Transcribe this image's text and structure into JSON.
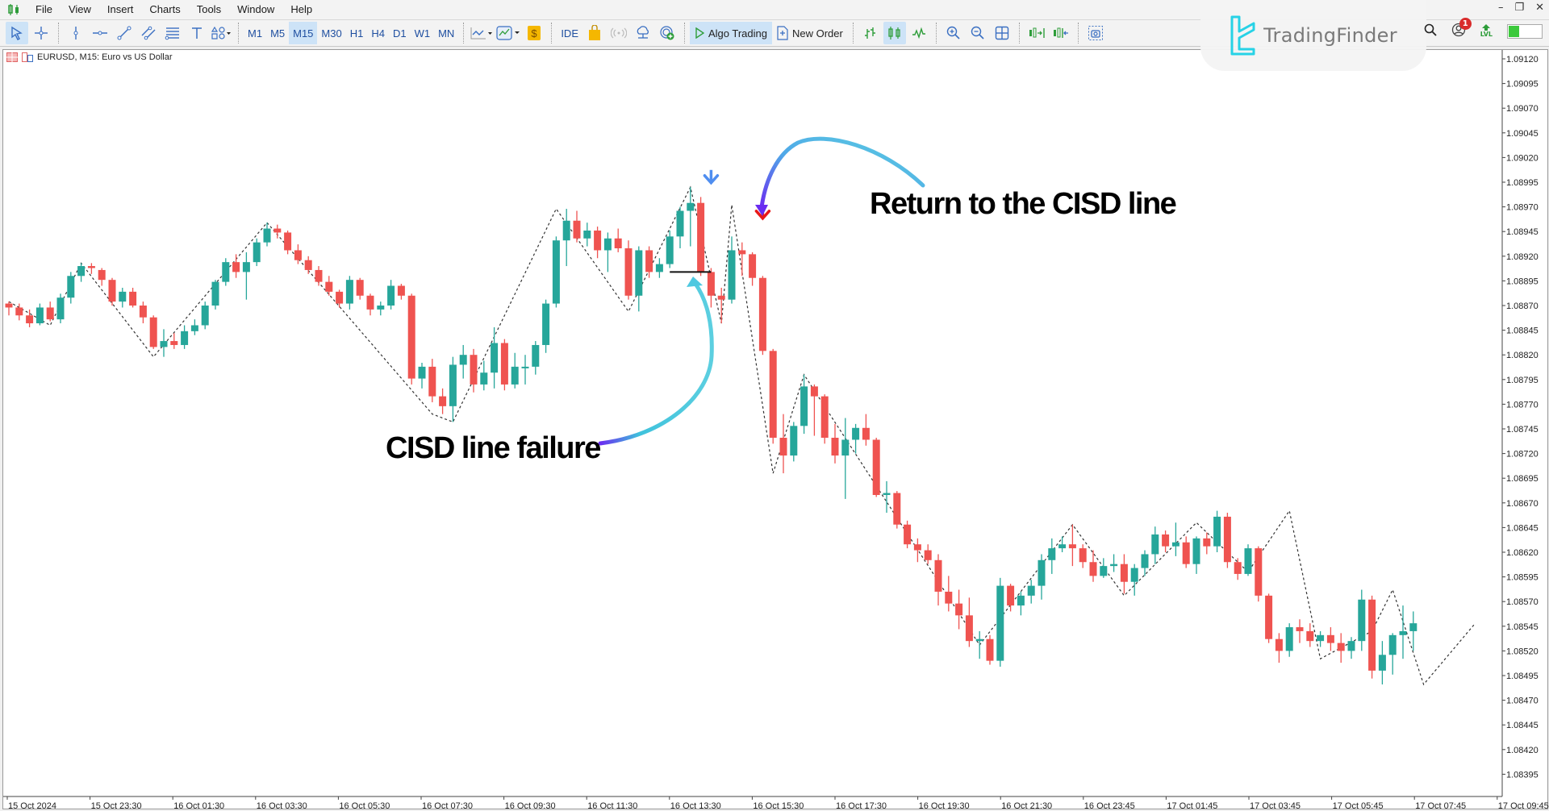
{
  "app": {
    "menu": [
      "File",
      "View",
      "Insert",
      "Charts",
      "Tools",
      "Window",
      "Help"
    ],
    "window_controls": [
      "minimize",
      "restore",
      "close"
    ]
  },
  "toolbar": {
    "drawing_tools": [
      "cursor-icon",
      "crosshair-icon",
      "vertical-line-icon",
      "horizontal-line-icon",
      "trendline-icon",
      "channel-icon",
      "fibonacci-icon",
      "text-icon",
      "shapes-icon"
    ],
    "timeframes": [
      "M1",
      "M5",
      "M15",
      "M30",
      "H1",
      "H4",
      "D1",
      "W1",
      "MN"
    ],
    "active_timeframe": "M15",
    "ide_label": "IDE",
    "algo_trading_label": "Algo Trading",
    "new_order_label": "New Order",
    "notification_count": "1",
    "level_label": "LVL",
    "level_progress": 0.3
  },
  "brand": {
    "name": "TradingFinder"
  },
  "chart": {
    "title": "EURUSD, M15:  Euro vs US Dollar",
    "bull_color": "#26a69a",
    "bear_color": "#ef5350",
    "annotations": {
      "failure": "CISD line failure",
      "return": "Return to the CISD line"
    }
  },
  "chart_data": {
    "type": "candlestick",
    "symbol": "EURUSD",
    "timeframe": "M15",
    "title": "EURUSD, M15:  Euro vs US Dollar",
    "ylim": [
      1.0837,
      1.09145
    ],
    "y_ticks": [
      "1.09120",
      "1.09095",
      "1.09070",
      "1.09045",
      "1.09020",
      "1.08995",
      "1.08970",
      "1.08945",
      "1.08920",
      "1.08895",
      "1.08870",
      "1.08845",
      "1.08820",
      "1.08795",
      "1.08770",
      "1.08745",
      "1.08720",
      "1.08695",
      "1.08670",
      "1.08645",
      "1.08620",
      "1.08595",
      "1.08570",
      "1.08545",
      "1.08520",
      "1.08495",
      "1.08470",
      "1.08445",
      "1.08420",
      "1.08395"
    ],
    "x_ticks": [
      "15 Oct 2024",
      "15 Oct 23:30",
      "16 Oct 01:30",
      "16 Oct 03:30",
      "16 Oct 05:30",
      "16 Oct 07:30",
      "16 Oct 09:30",
      "16 Oct 11:30",
      "16 Oct 13:30",
      "16 Oct 15:30",
      "16 Oct 17:30",
      "16 Oct 19:30",
      "16 Oct 21:30",
      "16 Oct 23:45",
      "17 Oct 01:45",
      "17 Oct 03:45",
      "17 Oct 05:45",
      "17 Oct 07:45",
      "17 Oct 09:45"
    ],
    "candles": [
      [
        1.08872,
        1.08874,
        1.0886,
        1.08868
      ],
      [
        1.08868,
        1.08872,
        1.08855,
        1.0886
      ],
      [
        1.0886,
        1.08866,
        1.08848,
        1.08852
      ],
      [
        1.08852,
        1.08872,
        1.0885,
        1.08868
      ],
      [
        1.08868,
        1.08874,
        1.08854,
        1.08856
      ],
      [
        1.08856,
        1.08882,
        1.08852,
        1.08878
      ],
      [
        1.08878,
        1.08904,
        1.08872,
        1.089
      ],
      [
        1.089,
        1.08913,
        1.08894,
        1.0891
      ],
      [
        1.0891,
        1.08913,
        1.08902,
        1.08908
      ],
      [
        1.08906,
        1.08908,
        1.0889,
        1.08896
      ],
      [
        1.08896,
        1.08898,
        1.0887,
        1.08874
      ],
      [
        1.08874,
        1.08888,
        1.08868,
        1.08884
      ],
      [
        1.08884,
        1.08888,
        1.08868,
        1.0887
      ],
      [
        1.0887,
        1.08874,
        1.08852,
        1.08858
      ],
      [
        1.08858,
        1.0886,
        1.08826,
        1.08828
      ],
      [
        1.08828,
        1.08846,
        1.08818,
        1.08834
      ],
      [
        1.08834,
        1.08842,
        1.08826,
        1.0883
      ],
      [
        1.0883,
        1.0885,
        1.08826,
        1.08844
      ],
      [
        1.08844,
        1.08856,
        1.0884,
        1.0885
      ],
      [
        1.0885,
        1.08874,
        1.08846,
        1.0887
      ],
      [
        1.0887,
        1.08896,
        1.08866,
        1.08894
      ],
      [
        1.08894,
        1.08918,
        1.0889,
        1.08914
      ],
      [
        1.08914,
        1.08922,
        1.08898,
        1.08904
      ],
      [
        1.08904,
        1.08924,
        1.08876,
        1.08914
      ],
      [
        1.08914,
        1.08938,
        1.0891,
        1.08934
      ],
      [
        1.08934,
        1.08954,
        1.0893,
        1.08948
      ],
      [
        1.08948,
        1.08952,
        1.08938,
        1.08944
      ],
      [
        1.08944,
        1.08946,
        1.08922,
        1.08926
      ],
      [
        1.08926,
        1.08932,
        1.08912,
        1.08916
      ],
      [
        1.08916,
        1.0892,
        1.08902,
        1.08906
      ],
      [
        1.08906,
        1.0891,
        1.0889,
        1.08894
      ],
      [
        1.08894,
        1.089,
        1.0888,
        1.08884
      ],
      [
        1.08884,
        1.08886,
        1.08868,
        1.08872
      ],
      [
        1.08872,
        1.089,
        1.08866,
        1.08896
      ],
      [
        1.08896,
        1.08898,
        1.08876,
        1.0888
      ],
      [
        1.0888,
        1.08882,
        1.0886,
        1.08866
      ],
      [
        1.08866,
        1.08874,
        1.0886,
        1.0887
      ],
      [
        1.0887,
        1.08896,
        1.08866,
        1.0889
      ],
      [
        1.0889,
        1.08892,
        1.08876,
        1.0888
      ],
      [
        1.0888,
        1.08882,
        1.0879,
        1.08796
      ],
      [
        1.08796,
        1.08812,
        1.08786,
        1.08808
      ],
      [
        1.08808,
        1.08816,
        1.08772,
        1.08778
      ],
      [
        1.08778,
        1.08786,
        1.0876,
        1.08768
      ],
      [
        1.08768,
        1.08818,
        1.08752,
        1.0881
      ],
      [
        1.0881,
        1.0883,
        1.08796,
        1.0882
      ],
      [
        1.0882,
        1.08826,
        1.08782,
        1.0879
      ],
      [
        1.0879,
        1.08814,
        1.08784,
        1.08802
      ],
      [
        1.08802,
        1.08848,
        1.08786,
        1.08832
      ],
      [
        1.08832,
        1.08836,
        1.08784,
        1.0879
      ],
      [
        1.0879,
        1.08822,
        1.08786,
        1.08808
      ],
      [
        1.08808,
        1.0882,
        1.0879,
        1.08808
      ],
      [
        1.08808,
        1.08834,
        1.088,
        1.0883
      ],
      [
        1.0883,
        1.08876,
        1.08822,
        1.08872
      ],
      [
        1.08872,
        1.0894,
        1.08868,
        1.08936
      ],
      [
        1.08936,
        1.08968,
        1.0891,
        1.08956
      ],
      [
        1.08956,
        1.08966,
        1.08934,
        1.08938
      ],
      [
        1.08938,
        1.08954,
        1.0893,
        1.08946
      ],
      [
        1.08946,
        1.0895,
        1.08918,
        1.08926
      ],
      [
        1.08926,
        1.08944,
        1.08904,
        1.08938
      ],
      [
        1.08938,
        1.08948,
        1.08924,
        1.08928
      ],
      [
        1.08928,
        1.08936,
        1.08876,
        1.0888
      ],
      [
        1.0888,
        1.0893,
        1.08864,
        1.08926
      ],
      [
        1.08926,
        1.0893,
        1.08898,
        1.08904
      ],
      [
        1.08904,
        1.08918,
        1.08898,
        1.08912
      ],
      [
        1.08912,
        1.08946,
        1.08908,
        1.0894
      ],
      [
        1.0894,
        1.0897,
        1.08928,
        1.08966
      ],
      [
        1.08966,
        1.0899,
        1.0893,
        1.08974
      ],
      [
        1.08974,
        1.0898,
        1.089,
        1.08904
      ],
      [
        1.08904,
        1.08908,
        1.08868,
        1.0888
      ],
      [
        1.0888,
        1.08888,
        1.08852,
        1.08876
      ],
      [
        1.08876,
        1.0894,
        1.08872,
        1.08926
      ],
      [
        1.08926,
        1.08934,
        1.089,
        1.08922
      ],
      [
        1.08922,
        1.08924,
        1.0889,
        1.08898
      ],
      [
        1.08898,
        1.089,
        1.0882,
        1.08824
      ],
      [
        1.08824,
        1.08826,
        1.0873,
        1.08736
      ],
      [
        1.08736,
        1.0876,
        1.087,
        1.08718
      ],
      [
        1.08718,
        1.08752,
        1.08712,
        1.08748
      ],
      [
        1.08748,
        1.088,
        1.0874,
        1.08788
      ],
      [
        1.08788,
        1.0879,
        1.08738,
        1.08778
      ],
      [
        1.08778,
        1.0878,
        1.0873,
        1.08736
      ],
      [
        1.08736,
        1.0875,
        1.0871,
        1.08718
      ],
      [
        1.08718,
        1.08756,
        1.08674,
        1.08734
      ],
      [
        1.08734,
        1.0875,
        1.0872,
        1.08746
      ],
      [
        1.08746,
        1.0876,
        1.08728,
        1.08734
      ],
      [
        1.08734,
        1.08736,
        1.08676,
        1.08678
      ],
      [
        1.08678,
        1.08692,
        1.0866,
        1.0868
      ],
      [
        1.0868,
        1.08682,
        1.08644,
        1.08648
      ],
      [
        1.08648,
        1.08652,
        1.08624,
        1.08628
      ],
      [
        1.08628,
        1.08634,
        1.0861,
        1.08622
      ],
      [
        1.08622,
        1.08628,
        1.08608,
        1.08612
      ],
      [
        1.08612,
        1.08618,
        1.08566,
        1.0858
      ],
      [
        1.0858,
        1.08596,
        1.0856,
        1.08568
      ],
      [
        1.08568,
        1.08582,
        1.08542,
        1.08556
      ],
      [
        1.08556,
        1.08574,
        1.08524,
        1.0853
      ],
      [
        1.0853,
        1.0854,
        1.08512,
        1.08532
      ],
      [
        1.08532,
        1.08536,
        1.08506,
        1.0851
      ],
      [
        1.0851,
        1.08594,
        1.08504,
        1.08586
      ],
      [
        1.08586,
        1.08588,
        1.0856,
        1.08566
      ],
      [
        1.08566,
        1.0858,
        1.08556,
        1.08576
      ],
      [
        1.08576,
        1.08592,
        1.08568,
        1.08586
      ],
      [
        1.08586,
        1.08618,
        1.08572,
        1.08612
      ],
      [
        1.08612,
        1.08634,
        1.08598,
        1.08624
      ],
      [
        1.08624,
        1.08636,
        1.0862,
        1.08628
      ],
      [
        1.08628,
        1.08648,
        1.08606,
        1.08624
      ],
      [
        1.08624,
        1.08628,
        1.08604,
        1.0861
      ],
      [
        1.0861,
        1.08622,
        1.0859,
        1.08596
      ],
      [
        1.08596,
        1.08614,
        1.08594,
        1.08606
      ],
      [
        1.08606,
        1.08618,
        1.086,
        1.08608
      ],
      [
        1.08608,
        1.08618,
        1.08578,
        1.0859
      ],
      [
        1.0859,
        1.08608,
        1.08576,
        1.08604
      ],
      [
        1.08604,
        1.08622,
        1.08596,
        1.08618
      ],
      [
        1.08618,
        1.08646,
        1.08608,
        1.08638
      ],
      [
        1.08638,
        1.08642,
        1.0862,
        1.08626
      ],
      [
        1.08626,
        1.0865,
        1.08616,
        1.0863
      ],
      [
        1.0863,
        1.08636,
        1.08604,
        1.08608
      ],
      [
        1.08608,
        1.08636,
        1.08598,
        1.08634
      ],
      [
        1.08634,
        1.0864,
        1.08618,
        1.08626
      ],
      [
        1.08626,
        1.08662,
        1.0862,
        1.08656
      ],
      [
        1.08656,
        1.0866,
        1.08604,
        1.0861
      ],
      [
        1.0861,
        1.08614,
        1.08592,
        1.08598
      ],
      [
        1.08598,
        1.08628,
        1.08596,
        1.08624
      ],
      [
        1.08624,
        1.08626,
        1.0857,
        1.08576
      ],
      [
        1.08576,
        1.08578,
        1.08528,
        1.08532
      ],
      [
        1.08532,
        1.08538,
        1.08508,
        1.0852
      ],
      [
        1.0852,
        1.08548,
        1.08514,
        1.08544
      ],
      [
        1.08544,
        1.08552,
        1.08528,
        1.0854
      ],
      [
        1.0854,
        1.08548,
        1.08524,
        1.0853
      ],
      [
        1.0853,
        1.0854,
        1.08524,
        1.08536
      ],
      [
        1.08536,
        1.08544,
        1.0852,
        1.08528
      ],
      [
        1.08528,
        1.08538,
        1.08508,
        1.0852
      ],
      [
        1.0852,
        1.08534,
        1.08512,
        1.0853
      ],
      [
        1.0853,
        1.08582,
        1.0852,
        1.08572
      ],
      [
        1.08572,
        1.08576,
        1.08492,
        1.085
      ],
      [
        1.085,
        1.0853,
        1.08486,
        1.08516
      ],
      [
        1.08516,
        1.08538,
        1.08496,
        1.08536
      ],
      [
        1.08536,
        1.08566,
        1.08512,
        1.0854
      ],
      [
        1.0854,
        1.0856,
        1.0852,
        1.08548
      ]
    ],
    "zigzag": [
      [
        0,
        1.08874
      ],
      [
        4,
        1.0885
      ],
      [
        7,
        1.08913
      ],
      [
        14,
        1.08818
      ],
      [
        25,
        1.08954
      ],
      [
        41,
        1.0876
      ],
      [
        43,
        1.08752
      ],
      [
        53,
        1.08968
      ],
      [
        60,
        1.08864
      ],
      [
        66,
        1.0899
      ],
      [
        69,
        1.08852
      ],
      [
        70,
        1.08972
      ],
      [
        74,
        1.087
      ],
      [
        77,
        1.088
      ],
      [
        94,
        1.08526
      ],
      [
        103,
        1.08648
      ],
      [
        108,
        1.08576
      ],
      [
        115,
        1.0865
      ],
      [
        120,
        1.086
      ],
      [
        124,
        1.08662
      ],
      [
        127,
        1.08512
      ],
      [
        132,
        1.0854
      ],
      [
        134,
        1.08582
      ],
      [
        137,
        1.08486
      ],
      [
        142,
        1.08548
      ]
    ],
    "cisd_line": {
      "from_bar": 64,
      "to_bar": 68,
      "price": 1.08904
    },
    "signals": [
      {
        "type": "arrow-down",
        "color": "#4f8ef0",
        "bar": 68,
        "price": 1.08996
      },
      {
        "type": "arrow-down",
        "color": "#e81919",
        "bar": 73,
        "price": 1.0896
      }
    ]
  }
}
